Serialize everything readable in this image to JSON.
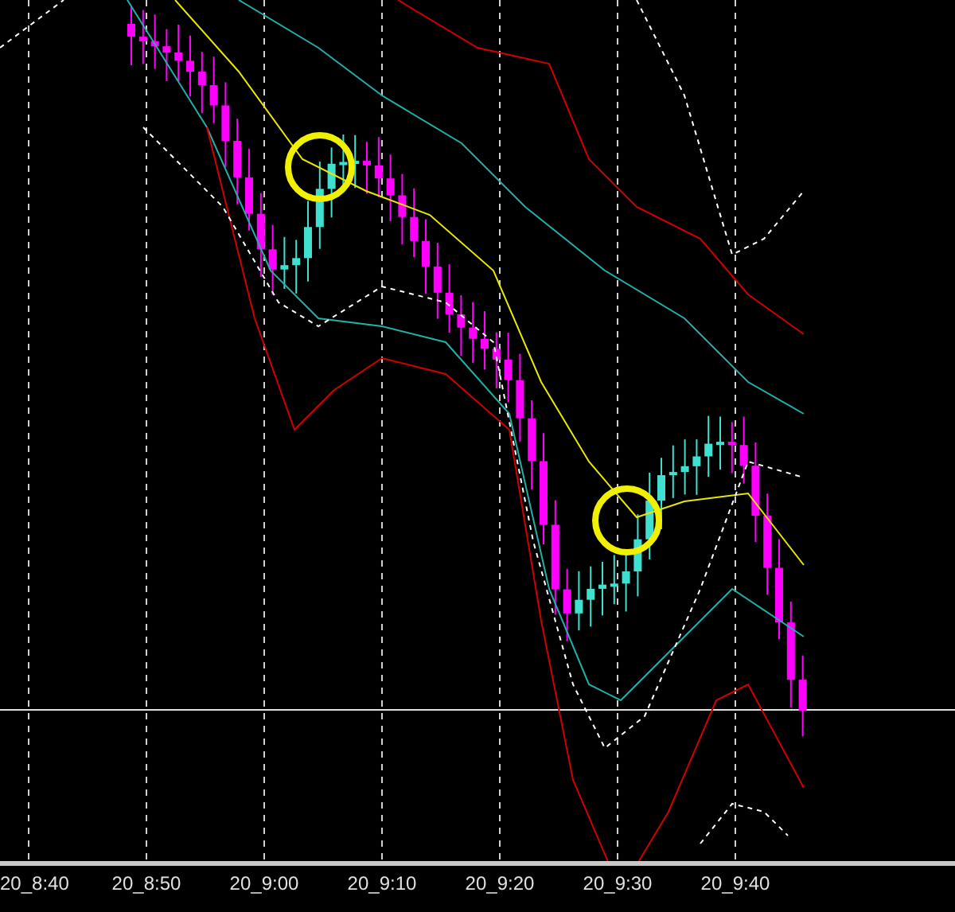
{
  "time_axis": {
    "labels": [
      "20_8:40",
      "20_8:50",
      "20_9:00",
      "20_9:10",
      "20_9:20",
      "20_9:30",
      "20_9:40"
    ]
  }
}
